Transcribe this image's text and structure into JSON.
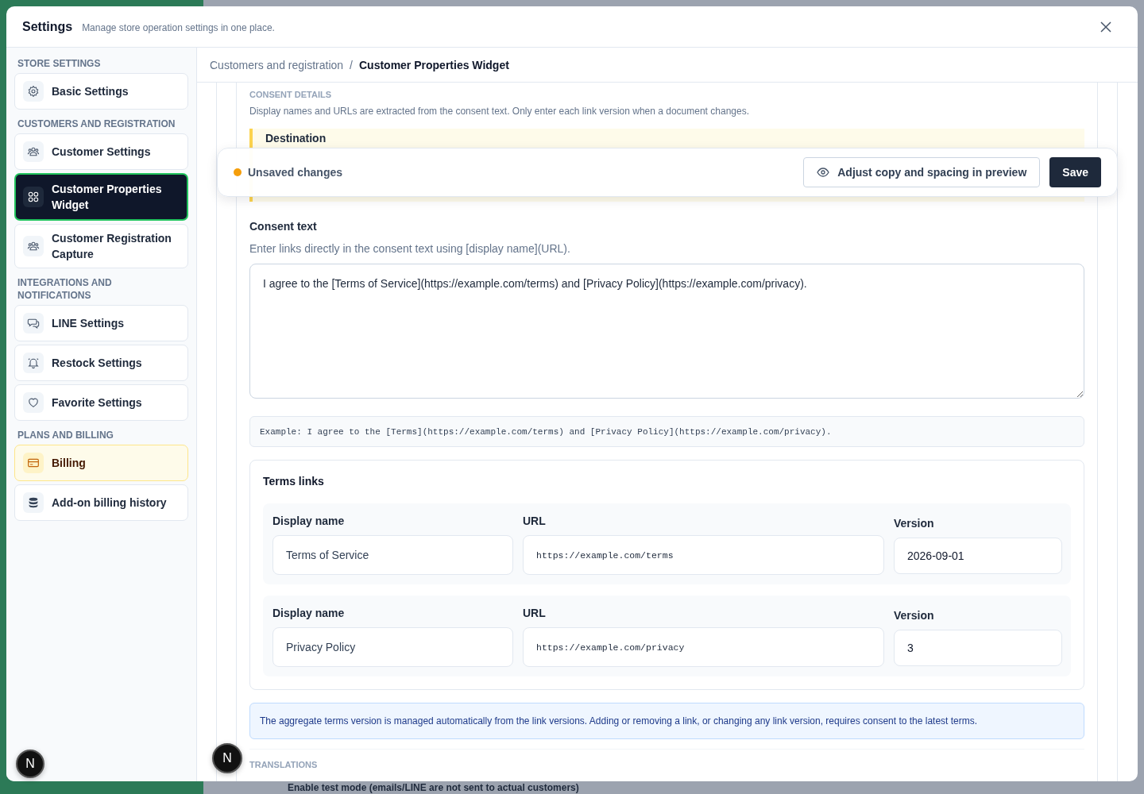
{
  "window": {
    "title": "Settings",
    "subtitle": "Manage store operation settings in one place."
  },
  "sidebar": {
    "groups": [
      {
        "heading": "STORE SETTINGS",
        "items": [
          {
            "label": "Basic Settings",
            "selected": false,
            "highlighted": false
          }
        ]
      },
      {
        "heading": "CUSTOMERS AND REGISTRATION",
        "items": [
          {
            "label": "Customer Settings",
            "selected": false,
            "highlighted": false
          },
          {
            "label": "Customer Properties Widget",
            "selected": true,
            "highlighted": false
          },
          {
            "label": "Customer Registration Capture",
            "selected": false,
            "highlighted": false
          }
        ]
      },
      {
        "heading": "INTEGRATIONS AND NOTIFICATIONS",
        "items": [
          {
            "label": "LINE Settings",
            "selected": false,
            "highlighted": false
          },
          {
            "label": "Restock Settings",
            "selected": false,
            "highlighted": false
          },
          {
            "label": "Favorite Settings",
            "selected": false,
            "highlighted": false
          }
        ]
      },
      {
        "heading": "PLANS AND BILLING",
        "items": [
          {
            "label": "Billing",
            "selected": false,
            "highlighted": true
          },
          {
            "label": "Add-on billing history",
            "selected": false,
            "highlighted": false
          }
        ]
      }
    ]
  },
  "breadcrumb": [
    {
      "label": "Customers and registration"
    },
    {
      "label": "Customer Properties Widget"
    }
  ],
  "breadcrumb_separator": "/",
  "consent_details": {
    "heading": "CONSENT DETAILS",
    "description": "Display names and URLs are extracted from the consent text. Only enter each link version when a document changes.",
    "callout_title": "Destination"
  },
  "unsaved_bar": {
    "status": "Unsaved changes",
    "preview_button": "Adjust copy and spacing in preview",
    "save_button": "Save"
  },
  "consent_text": {
    "label": "Consent text",
    "hint": "Enter links directly in the consent text using [display name](URL).",
    "value": "I agree to the [Terms of Service](https://example.com/terms) and [Privacy Policy](https://example.com/privacy).",
    "example": "Example: I agree to the [Terms](https://example.com/terms) and [Privacy Policy](https://example.com/privacy)."
  },
  "terms_links": {
    "title": "Terms links",
    "rows": [
      {
        "display_name_label": "Display name",
        "display_name": "Terms of Service",
        "url_label": "URL",
        "url": "https://example.com/terms",
        "version_label": "Version",
        "version": "2026-09-01"
      },
      {
        "display_name_label": "Display name",
        "display_name": "Privacy Policy",
        "url_label": "URL",
        "url": "https://example.com/privacy",
        "version_label": "Version",
        "version": "3"
      }
    ]
  },
  "info": "The aggregate terms version is managed automatically from the link versions. Adding or removing a link, or changing any link version, requires consent to the latest terms.",
  "translations_heading": "TRANSLATIONS",
  "background_text": "Enable test mode (emails/LINE are not sent to actual customers)",
  "dev_badges": [
    "N",
    "N"
  ]
}
